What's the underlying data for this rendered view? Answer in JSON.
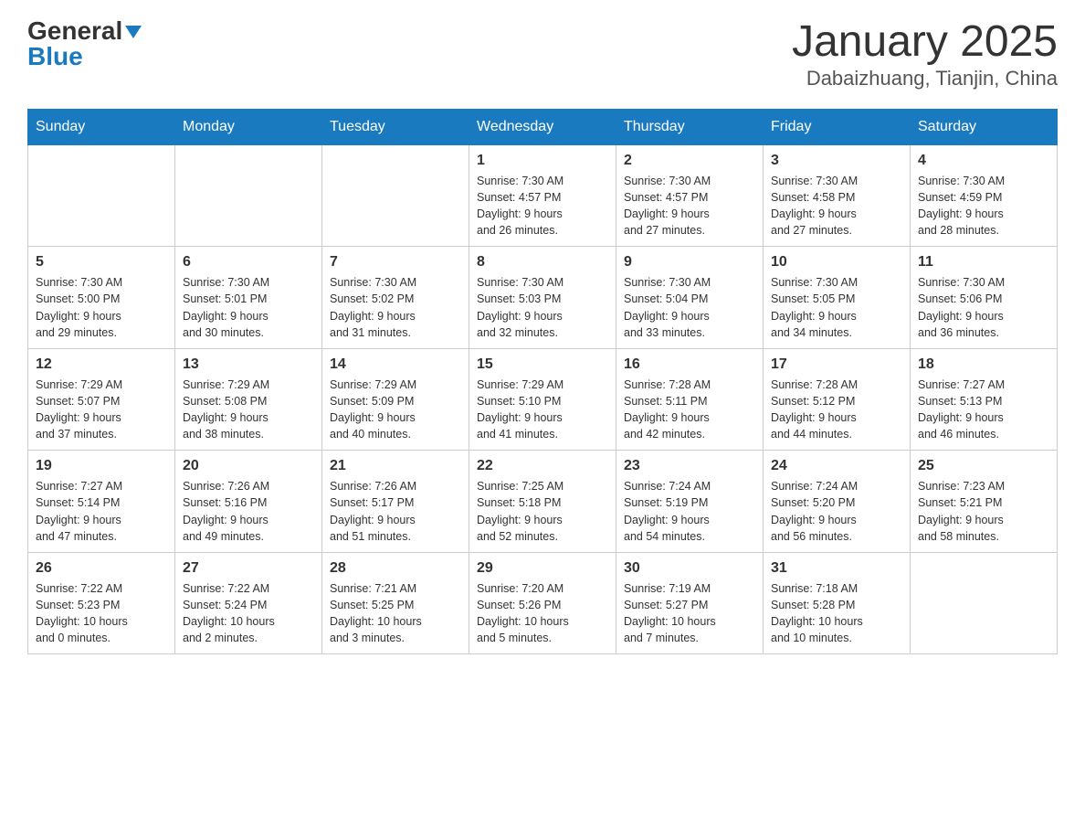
{
  "logo": {
    "general": "General",
    "blue": "Blue"
  },
  "title": "January 2025",
  "subtitle": "Dabaizhuang, Tianjin, China",
  "days_of_week": [
    "Sunday",
    "Monday",
    "Tuesday",
    "Wednesday",
    "Thursday",
    "Friday",
    "Saturday"
  ],
  "weeks": [
    [
      {
        "day": "",
        "info": ""
      },
      {
        "day": "",
        "info": ""
      },
      {
        "day": "",
        "info": ""
      },
      {
        "day": "1",
        "info": "Sunrise: 7:30 AM\nSunset: 4:57 PM\nDaylight: 9 hours\nand 26 minutes."
      },
      {
        "day": "2",
        "info": "Sunrise: 7:30 AM\nSunset: 4:57 PM\nDaylight: 9 hours\nand 27 minutes."
      },
      {
        "day": "3",
        "info": "Sunrise: 7:30 AM\nSunset: 4:58 PM\nDaylight: 9 hours\nand 27 minutes."
      },
      {
        "day": "4",
        "info": "Sunrise: 7:30 AM\nSunset: 4:59 PM\nDaylight: 9 hours\nand 28 minutes."
      }
    ],
    [
      {
        "day": "5",
        "info": "Sunrise: 7:30 AM\nSunset: 5:00 PM\nDaylight: 9 hours\nand 29 minutes."
      },
      {
        "day": "6",
        "info": "Sunrise: 7:30 AM\nSunset: 5:01 PM\nDaylight: 9 hours\nand 30 minutes."
      },
      {
        "day": "7",
        "info": "Sunrise: 7:30 AM\nSunset: 5:02 PM\nDaylight: 9 hours\nand 31 minutes."
      },
      {
        "day": "8",
        "info": "Sunrise: 7:30 AM\nSunset: 5:03 PM\nDaylight: 9 hours\nand 32 minutes."
      },
      {
        "day": "9",
        "info": "Sunrise: 7:30 AM\nSunset: 5:04 PM\nDaylight: 9 hours\nand 33 minutes."
      },
      {
        "day": "10",
        "info": "Sunrise: 7:30 AM\nSunset: 5:05 PM\nDaylight: 9 hours\nand 34 minutes."
      },
      {
        "day": "11",
        "info": "Sunrise: 7:30 AM\nSunset: 5:06 PM\nDaylight: 9 hours\nand 36 minutes."
      }
    ],
    [
      {
        "day": "12",
        "info": "Sunrise: 7:29 AM\nSunset: 5:07 PM\nDaylight: 9 hours\nand 37 minutes."
      },
      {
        "day": "13",
        "info": "Sunrise: 7:29 AM\nSunset: 5:08 PM\nDaylight: 9 hours\nand 38 minutes."
      },
      {
        "day": "14",
        "info": "Sunrise: 7:29 AM\nSunset: 5:09 PM\nDaylight: 9 hours\nand 40 minutes."
      },
      {
        "day": "15",
        "info": "Sunrise: 7:29 AM\nSunset: 5:10 PM\nDaylight: 9 hours\nand 41 minutes."
      },
      {
        "day": "16",
        "info": "Sunrise: 7:28 AM\nSunset: 5:11 PM\nDaylight: 9 hours\nand 42 minutes."
      },
      {
        "day": "17",
        "info": "Sunrise: 7:28 AM\nSunset: 5:12 PM\nDaylight: 9 hours\nand 44 minutes."
      },
      {
        "day": "18",
        "info": "Sunrise: 7:27 AM\nSunset: 5:13 PM\nDaylight: 9 hours\nand 46 minutes."
      }
    ],
    [
      {
        "day": "19",
        "info": "Sunrise: 7:27 AM\nSunset: 5:14 PM\nDaylight: 9 hours\nand 47 minutes."
      },
      {
        "day": "20",
        "info": "Sunrise: 7:26 AM\nSunset: 5:16 PM\nDaylight: 9 hours\nand 49 minutes."
      },
      {
        "day": "21",
        "info": "Sunrise: 7:26 AM\nSunset: 5:17 PM\nDaylight: 9 hours\nand 51 minutes."
      },
      {
        "day": "22",
        "info": "Sunrise: 7:25 AM\nSunset: 5:18 PM\nDaylight: 9 hours\nand 52 minutes."
      },
      {
        "day": "23",
        "info": "Sunrise: 7:24 AM\nSunset: 5:19 PM\nDaylight: 9 hours\nand 54 minutes."
      },
      {
        "day": "24",
        "info": "Sunrise: 7:24 AM\nSunset: 5:20 PM\nDaylight: 9 hours\nand 56 minutes."
      },
      {
        "day": "25",
        "info": "Sunrise: 7:23 AM\nSunset: 5:21 PM\nDaylight: 9 hours\nand 58 minutes."
      }
    ],
    [
      {
        "day": "26",
        "info": "Sunrise: 7:22 AM\nSunset: 5:23 PM\nDaylight: 10 hours\nand 0 minutes."
      },
      {
        "day": "27",
        "info": "Sunrise: 7:22 AM\nSunset: 5:24 PM\nDaylight: 10 hours\nand 2 minutes."
      },
      {
        "day": "28",
        "info": "Sunrise: 7:21 AM\nSunset: 5:25 PM\nDaylight: 10 hours\nand 3 minutes."
      },
      {
        "day": "29",
        "info": "Sunrise: 7:20 AM\nSunset: 5:26 PM\nDaylight: 10 hours\nand 5 minutes."
      },
      {
        "day": "30",
        "info": "Sunrise: 7:19 AM\nSunset: 5:27 PM\nDaylight: 10 hours\nand 7 minutes."
      },
      {
        "day": "31",
        "info": "Sunrise: 7:18 AM\nSunset: 5:28 PM\nDaylight: 10 hours\nand 10 minutes."
      },
      {
        "day": "",
        "info": ""
      }
    ]
  ]
}
